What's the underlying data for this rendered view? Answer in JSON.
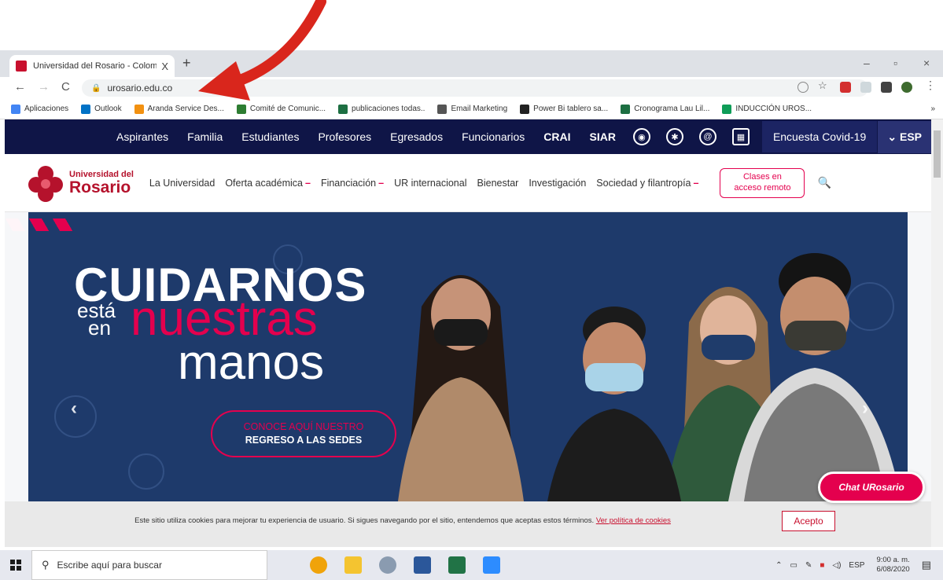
{
  "browser": {
    "tab_title": "Universidad del Rosario - Colom",
    "tab_close": "X",
    "new_tab": "+",
    "url": "urosario.edu.co",
    "back": "←",
    "forward": "→",
    "reload": "C",
    "minimize": "–",
    "restore": "▫",
    "close": "×",
    "bookmarks": [
      {
        "label": "Aplicaciones",
        "color": "#4285f4"
      },
      {
        "label": "Outlook",
        "color": "#0072c6"
      },
      {
        "label": "Aranda Service Des...",
        "color": "#f29111"
      },
      {
        "label": "Comité de Comunic...",
        "color": "#2e7d32"
      },
      {
        "label": "publicaciones todas..",
        "color": "#1d6f42"
      },
      {
        "label": "Email Marketing",
        "color": "#555555"
      },
      {
        "label": "Power Bi tablero sa...",
        "color": "#222222"
      },
      {
        "label": "Cronograma Lau Lil...",
        "color": "#1d6f42"
      },
      {
        "label": "INDUCCIÓN UROS...",
        "color": "#0f9d58"
      }
    ],
    "more_bookmarks": "»"
  },
  "site": {
    "topnav": {
      "items": [
        "Aspirantes",
        "Familia",
        "Estudiantes",
        "Profesores",
        "Egresados",
        "Funcionarios"
      ],
      "bold_items": [
        "CRAI",
        "SIAR"
      ],
      "covid_label": "Encuesta Covid-19",
      "lang_label": "ESP"
    },
    "logo": {
      "line1": "Universidad del",
      "line2": "Rosario"
    },
    "menu": [
      {
        "label": "La Universidad",
        "caret": ""
      },
      {
        "label": "Oferta académica",
        "caret": "–"
      },
      {
        "label": "Financiación",
        "caret": "–"
      },
      {
        "label": "UR internacional",
        "caret": ""
      },
      {
        "label": "Bienestar",
        "caret": ""
      },
      {
        "label": "Investigación",
        "caret": ""
      },
      {
        "label": "Sociedad y filantropía",
        "caret": "–"
      }
    ],
    "cta": {
      "line1": "Clases en",
      "line2": "acceso remoto"
    },
    "hero": {
      "h1": "CUIDARNOS",
      "h2a": "está",
      "h2b": "en",
      "h3": "nuestras",
      "h4": "manos",
      "btn_line1": "CONOCE AQUÍ NUESTRO",
      "btn_line2": "REGRESO A LAS SEDES",
      "prev": "‹",
      "next": "›"
    },
    "cookie": {
      "text": "Este sitio utiliza cookies para mejorar tu experiencia de usuario. Si sigues navegando por el sitio, entendemos que aceptas estos términos.",
      "link": "Ver política de cookies",
      "accept": "Acepto"
    },
    "chat_label": "Chat URosario"
  },
  "taskbar": {
    "search_placeholder": "Escribe aquí para buscar",
    "lang": "ESP",
    "time": "9:00 a. m.",
    "date": "6/08/2020"
  },
  "colors": {
    "brand_red": "#c8102e",
    "brand_pink": "#e4004e",
    "navy": "#0f1547",
    "hero_blue": "#1e3a6b"
  }
}
